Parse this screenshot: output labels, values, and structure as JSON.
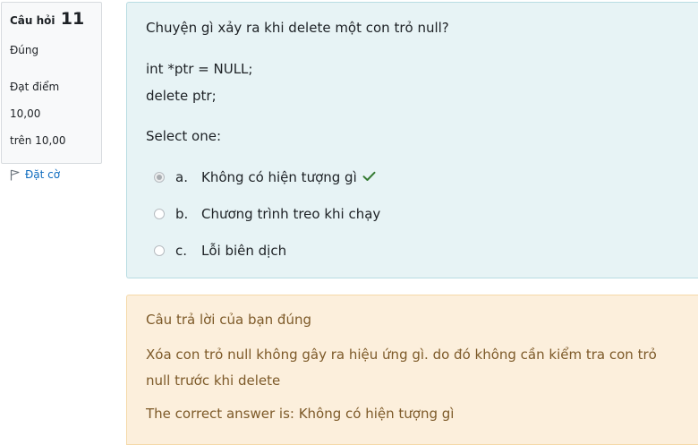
{
  "info": {
    "question_label": "Câu hỏi",
    "question_number": "11",
    "state": "Đúng",
    "grade_line1": "Đạt điểm 10,00",
    "grade_line2": "trên 10,00",
    "flag_label": "Đặt cờ",
    "flag_icon": "flag-icon"
  },
  "question": {
    "text": "Chuyện gì xảy ra khi delete một con trỏ null?",
    "code_line1": "int *ptr = NULL;",
    "code_line2": "delete ptr;",
    "prompt": "Select one:",
    "options": [
      {
        "letter": "a.",
        "text": "Không có hiện tượng gì",
        "selected": true,
        "correct": true
      },
      {
        "letter": "b.",
        "text": "Chương trình treo khi chạy",
        "selected": false,
        "correct": false
      },
      {
        "letter": "c.",
        "text": "Lỗi biên dịch",
        "selected": false,
        "correct": false
      }
    ],
    "correct_icon": "check-icon"
  },
  "feedback": {
    "specific": "Câu trả lời của bạn đúng",
    "general": "Xóa con trỏ null không gây ra hiệu ứng gì. do đó không cần kiểm tra con trỏ null trước khi delete",
    "right_answer": "The correct answer is: Không có hiện tượng gì"
  },
  "colors": {
    "formulation_bg": "#e7f3f5",
    "feedback_bg": "#fcefdc",
    "feedback_text": "#7d5a29",
    "check": "#357a32",
    "link": "#0f6cbf"
  }
}
